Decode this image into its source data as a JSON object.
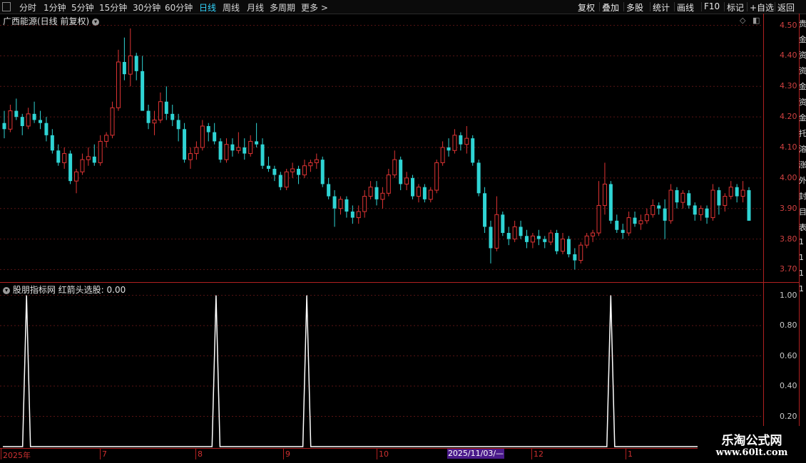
{
  "toolbar": {
    "left_items": [
      "分时",
      "1分钟",
      "5分钟",
      "15分钟",
      "30分钟",
      "60分钟",
      "日线",
      "周线",
      "月线",
      "多周期",
      "更多 >"
    ],
    "active_index": 6,
    "right_items": [
      "复权",
      "叠加",
      "多股",
      "统计",
      "画线",
      "F10",
      "标记",
      "+自选",
      "返回"
    ]
  },
  "main_chart": {
    "title": "广西能源(日线 前复权)",
    "price_ticks": [
      "4.50",
      "4.40",
      "4.30",
      "4.20",
      "4.10",
      "4.00",
      "3.90",
      "3.80",
      "3.70"
    ],
    "up_color": "#e03434",
    "down_color": "#2fd4d4"
  },
  "indicator": {
    "title": "股朋指标网 红箭头选股: 0.00",
    "ticks": [
      "1.00",
      "0.80",
      "0.60",
      "0.40",
      "0.20"
    ]
  },
  "date_axis": {
    "labels": [
      "2025年",
      "7",
      "8",
      "9",
      "10",
      "12",
      "1"
    ],
    "cursor_label": "2025/11/03/—"
  },
  "right_strip_chars": [
    "贵",
    "金",
    "资",
    "资",
    "金",
    "资",
    "金",
    "托",
    "溶",
    "涨",
    "外",
    "封",
    "目",
    "表",
    "1",
    "1",
    "1",
    "1"
  ],
  "watermark": {
    "line1": "乐淘公式网",
    "line2": "www.60lt.com"
  },
  "chart_data": {
    "type": "candlestick",
    "ylim": [
      3.68,
      4.52
    ],
    "candles": [
      [
        4.18,
        4.22,
        4.13,
        4.16
      ],
      [
        4.16,
        4.24,
        4.15,
        4.22
      ],
      [
        4.22,
        4.26,
        4.19,
        4.2
      ],
      [
        4.2,
        4.21,
        4.14,
        4.17
      ],
      [
        4.17,
        4.23,
        4.16,
        4.21
      ],
      [
        4.21,
        4.25,
        4.18,
        4.19
      ],
      [
        4.19,
        4.22,
        4.16,
        4.18
      ],
      [
        4.18,
        4.2,
        4.12,
        4.14
      ],
      [
        4.14,
        4.16,
        4.08,
        4.09
      ],
      [
        4.09,
        4.11,
        4.04,
        4.05
      ],
      [
        4.05,
        4.1,
        4.03,
        4.08
      ],
      [
        4.08,
        4.09,
        3.98,
        3.99
      ],
      [
        3.99,
        4.03,
        3.95,
        4.02
      ],
      [
        4.02,
        4.08,
        4.01,
        4.06
      ],
      [
        4.06,
        4.1,
        4.04,
        4.07
      ],
      [
        4.07,
        4.11,
        4.04,
        4.05
      ],
      [
        4.05,
        4.14,
        4.04,
        4.12
      ],
      [
        4.12,
        4.15,
        4.1,
        4.14
      ],
      [
        4.14,
        4.25,
        4.13,
        4.23
      ],
      [
        4.23,
        4.42,
        4.22,
        4.38
      ],
      [
        4.38,
        4.46,
        4.32,
        4.34
      ],
      [
        4.34,
        4.49,
        4.3,
        4.4
      ],
      [
        4.4,
        4.41,
        4.32,
        4.35
      ],
      [
        4.35,
        4.4,
        4.26,
        4.22
      ],
      [
        4.22,
        4.24,
        4.16,
        4.18
      ],
      [
        4.18,
        4.22,
        4.14,
        4.19
      ],
      [
        4.19,
        4.28,
        4.18,
        4.25
      ],
      [
        4.25,
        4.3,
        4.19,
        4.21
      ],
      [
        4.21,
        4.24,
        4.17,
        4.19
      ],
      [
        4.19,
        4.21,
        4.12,
        4.16
      ],
      [
        4.16,
        4.18,
        4.05,
        4.06
      ],
      [
        4.06,
        4.1,
        4.03,
        4.08
      ],
      [
        4.08,
        4.12,
        4.06,
        4.1
      ],
      [
        4.1,
        4.19,
        4.09,
        4.17
      ],
      [
        4.17,
        4.18,
        4.12,
        4.15
      ],
      [
        4.15,
        4.18,
        4.11,
        4.12
      ],
      [
        4.12,
        4.13,
        4.05,
        4.06
      ],
      [
        4.06,
        4.13,
        4.05,
        4.11
      ],
      [
        4.11,
        4.13,
        4.07,
        4.09
      ],
      [
        4.09,
        4.15,
        4.08,
        4.1
      ],
      [
        4.1,
        4.13,
        4.06,
        4.08
      ],
      [
        4.08,
        4.14,
        4.07,
        4.12
      ],
      [
        4.12,
        4.18,
        4.1,
        4.11
      ],
      [
        4.11,
        4.13,
        4.03,
        4.04
      ],
      [
        4.04,
        4.07,
        4.02,
        4.03
      ],
      [
        4.03,
        4.04,
        3.99,
        4.01
      ],
      [
        4.01,
        4.02,
        3.96,
        3.97
      ],
      [
        3.97,
        4.03,
        3.96,
        4.02
      ],
      [
        4.02,
        4.05,
        4.0,
        4.03
      ],
      [
        4.03,
        4.04,
        3.98,
        4.01
      ],
      [
        4.01,
        4.06,
        4.0,
        4.04
      ],
      [
        4.04,
        4.06,
        4.02,
        4.05
      ],
      [
        4.05,
        4.08,
        4.03,
        4.06
      ],
      [
        4.06,
        4.07,
        3.97,
        3.98
      ],
      [
        3.98,
        4.0,
        3.93,
        3.94
      ],
      [
        3.94,
        3.96,
        3.84,
        3.9
      ],
      [
        3.9,
        3.94,
        3.88,
        3.93
      ],
      [
        3.93,
        3.94,
        3.87,
        3.89
      ],
      [
        3.89,
        3.91,
        3.85,
        3.87
      ],
      [
        3.87,
        3.91,
        3.85,
        3.89
      ],
      [
        3.89,
        3.96,
        3.87,
        3.94
      ],
      [
        3.94,
        3.99,
        3.93,
        3.97
      ],
      [
        3.97,
        3.99,
        3.91,
        3.93
      ],
      [
        3.93,
        3.97,
        3.9,
        3.95
      ],
      [
        3.95,
        4.03,
        3.94,
        4.01
      ],
      [
        4.01,
        4.09,
        4.0,
        4.06
      ],
      [
        4.06,
        4.07,
        3.96,
        3.98
      ],
      [
        3.98,
        4.02,
        3.96,
        4.0
      ],
      [
        4.0,
        4.01,
        3.93,
        3.94
      ],
      [
        3.94,
        3.98,
        3.92,
        3.97
      ],
      [
        3.97,
        3.98,
        3.92,
        3.93
      ],
      [
        3.93,
        3.97,
        3.92,
        3.96
      ],
      [
        3.96,
        4.06,
        3.95,
        4.05
      ],
      [
        4.05,
        4.12,
        4.04,
        4.1
      ],
      [
        4.1,
        4.13,
        4.07,
        4.09
      ],
      [
        4.09,
        4.16,
        4.08,
        4.14
      ],
      [
        4.14,
        4.15,
        4.09,
        4.11
      ],
      [
        4.11,
        4.17,
        4.08,
        4.13
      ],
      [
        4.13,
        4.14,
        4.04,
        4.05
      ],
      [
        4.05,
        4.06,
        3.94,
        3.95
      ],
      [
        3.95,
        3.97,
        3.82,
        3.84
      ],
      [
        3.84,
        3.86,
        3.72,
        3.77
      ],
      [
        3.77,
        3.94,
        3.76,
        3.88
      ],
      [
        3.88,
        3.89,
        3.81,
        3.82
      ],
      [
        3.82,
        3.84,
        3.78,
        3.8
      ],
      [
        3.8,
        3.86,
        3.79,
        3.84
      ],
      [
        3.84,
        3.86,
        3.8,
        3.81
      ],
      [
        3.81,
        3.83,
        3.77,
        3.79
      ],
      [
        3.79,
        3.82,
        3.77,
        3.81
      ],
      [
        3.81,
        3.83,
        3.78,
        3.8
      ],
      [
        3.8,
        3.81,
        3.77,
        3.79
      ],
      [
        3.79,
        3.83,
        3.78,
        3.82
      ],
      [
        3.82,
        3.83,
        3.75,
        3.76
      ],
      [
        3.76,
        3.82,
        3.75,
        3.8
      ],
      [
        3.8,
        3.81,
        3.74,
        3.75
      ],
      [
        3.75,
        3.77,
        3.7,
        3.73
      ],
      [
        3.73,
        3.79,
        3.72,
        3.78
      ],
      [
        3.78,
        3.82,
        3.77,
        3.81
      ],
      [
        3.81,
        3.83,
        3.79,
        3.82
      ],
      [
        3.82,
        3.99,
        3.81,
        3.91
      ],
      [
        3.91,
        4.05,
        3.88,
        3.98
      ],
      [
        3.98,
        3.99,
        3.85,
        3.86
      ],
      [
        3.86,
        3.88,
        3.82,
        3.83
      ],
      [
        3.83,
        3.85,
        3.8,
        3.82
      ],
      [
        3.82,
        3.89,
        3.81,
        3.87
      ],
      [
        3.87,
        3.89,
        3.84,
        3.85
      ],
      [
        3.85,
        3.88,
        3.83,
        3.86
      ],
      [
        3.86,
        3.9,
        3.85,
        3.88
      ],
      [
        3.88,
        3.93,
        3.87,
        3.91
      ],
      [
        3.91,
        3.92,
        3.88,
        3.9
      ],
      [
        3.9,
        3.93,
        3.8,
        3.86
      ],
      [
        3.86,
        3.98,
        3.85,
        3.96
      ],
      [
        3.96,
        3.97,
        3.9,
        3.92
      ],
      [
        3.92,
        3.96,
        3.9,
        3.95
      ],
      [
        3.95,
        3.96,
        3.9,
        3.91
      ],
      [
        3.91,
        3.92,
        3.86,
        3.88
      ],
      [
        3.88,
        3.91,
        3.86,
        3.9
      ],
      [
        3.9,
        3.91,
        3.85,
        3.87
      ],
      [
        3.87,
        3.98,
        3.86,
        3.96
      ],
      [
        3.96,
        3.97,
        3.88,
        3.91
      ],
      [
        3.91,
        3.95,
        3.89,
        3.94
      ],
      [
        3.94,
        3.99,
        3.93,
        3.97
      ],
      [
        3.97,
        3.98,
        3.92,
        3.94
      ],
      [
        3.94,
        3.99,
        3.92,
        3.96
      ],
      [
        3.96,
        3.97,
        3.86,
        3.86
      ]
    ],
    "indicator_series": {
      "name": "红箭头选股",
      "spike_indices": [
        6,
        54,
        77,
        154
      ],
      "total_points": 190,
      "ylim": [
        0,
        1.05
      ]
    }
  }
}
